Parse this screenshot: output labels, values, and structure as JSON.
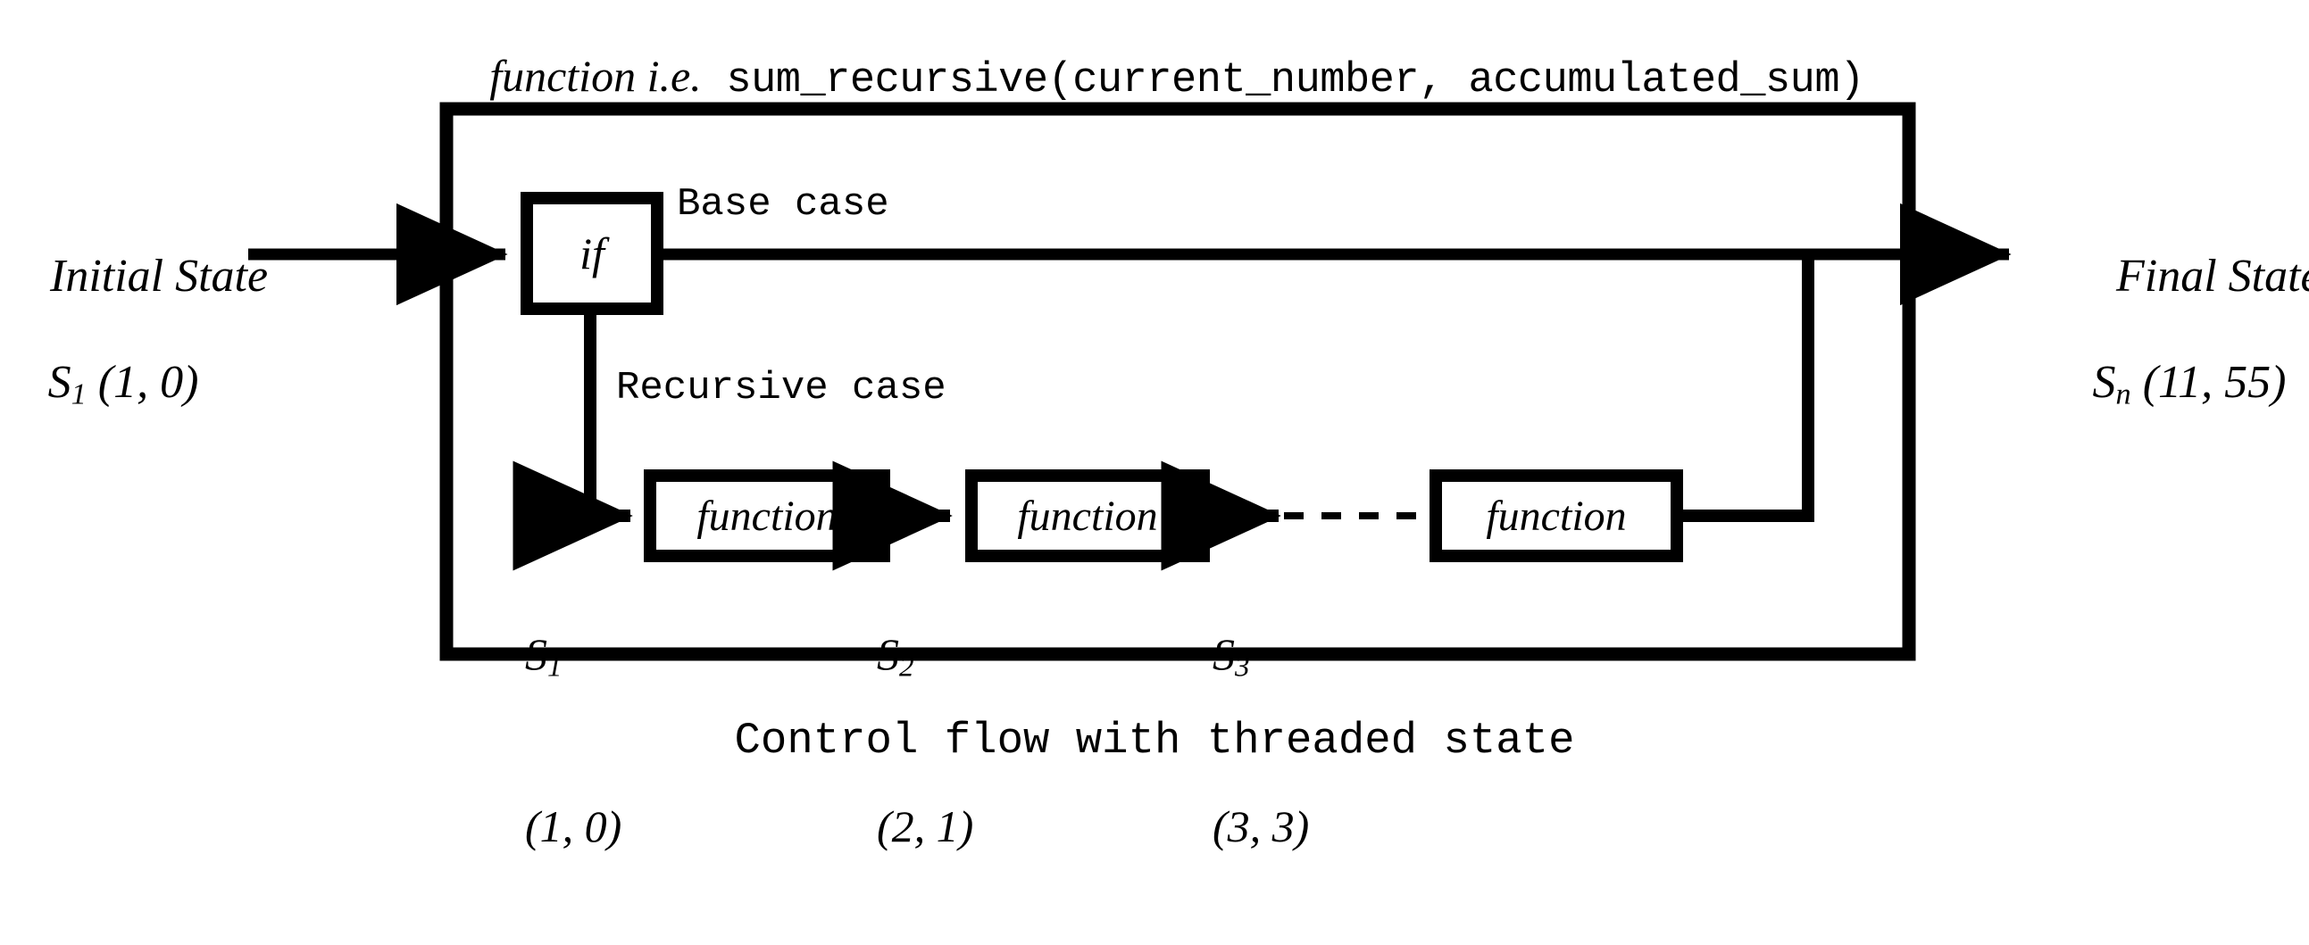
{
  "title": {
    "prefix_italic": "function i.e.",
    "signature_mono": " sum_recursive(current_number, accumulated_sum)"
  },
  "caption": "Control flow with threaded state",
  "left_label": {
    "line1": "Initial State",
    "state_name": "S",
    "state_index": "1",
    "state_value": " (1, 0)"
  },
  "right_label": {
    "line1": "Final State",
    "state_name": "S",
    "state_index": "n",
    "state_value": " (11, 55)"
  },
  "branches": {
    "base_case": "Base case",
    "recursive_case": "Recursive case"
  },
  "nodes": {
    "condition_box": "if",
    "function_box_1": "function",
    "function_box_2": "function",
    "function_box_3": "function"
  },
  "state_annotations": [
    {
      "name": "S",
      "index": "1",
      "value": "(1, 0)"
    },
    {
      "name": "S",
      "index": "2",
      "value": "(2, 1)"
    },
    {
      "name": "S",
      "index": "3",
      "value": "(3, 3)"
    }
  ],
  "colors": {
    "stroke": "#000000",
    "background": "#ffffff"
  },
  "icons": {
    "arrow_in": "arrow-right-icon",
    "arrow_out": "arrow-right-icon",
    "ellipsis_connector": "dashed-line-icon"
  }
}
